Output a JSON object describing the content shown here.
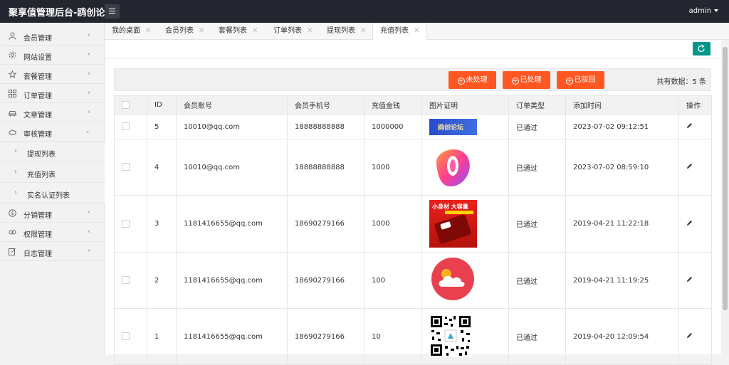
{
  "header": {
    "brand": "聚享值管理后台-鸥创论",
    "user": "admin"
  },
  "sidebar": {
    "items": [
      {
        "label": "会员管理",
        "icon": "user-icon",
        "arrow": "‹"
      },
      {
        "label": "网站设置",
        "icon": "gear-icon",
        "arrow": "‹"
      },
      {
        "label": "套餐管理",
        "icon": "star-icon",
        "arrow": "‹"
      },
      {
        "label": "订单管理",
        "icon": "grid-icon",
        "arrow": "‹"
      },
      {
        "label": "文章管理",
        "icon": "car-icon",
        "arrow": "‹"
      },
      {
        "label": "审核管理",
        "icon": "hand-icon",
        "arrow": "⌄"
      },
      {
        "label": "分销管理",
        "icon": "dollar-icon",
        "arrow": "‹"
      },
      {
        "label": "权限管理",
        "icon": "link-icon",
        "arrow": "‹"
      },
      {
        "label": "日志管理",
        "icon": "edit-icon",
        "arrow": "‹"
      }
    ],
    "subitems": [
      {
        "label": "提现列表"
      },
      {
        "label": "充值列表"
      },
      {
        "label": "实名认证列表"
      }
    ]
  },
  "tabs": [
    {
      "label": "我的桌面"
    },
    {
      "label": "会员列表"
    },
    {
      "label": "套餐列表"
    },
    {
      "label": "订单列表"
    },
    {
      "label": "提现列表"
    },
    {
      "label": "充值列表"
    }
  ],
  "toolbar": {
    "btn_pending": "未处理",
    "btn_processed": "已处理",
    "btn_rejected": "已驳回",
    "total": "共有数据：5 条"
  },
  "table": {
    "columns": [
      "ID",
      "会员账号",
      "会员手机号",
      "充值金钱",
      "图片证明",
      "订单类型",
      "添加时间",
      "操作"
    ],
    "rows": [
      {
        "id": "5",
        "account": "10010@qq.com",
        "phone": "18888888888",
        "amount": "1000000",
        "image_text": "鸥创论坛",
        "type": "已通过",
        "time": "2023-07-02 09:12:51"
      },
      {
        "id": "4",
        "account": "10010@qq.com",
        "phone": "18888888888",
        "amount": "1000",
        "type": "已通过",
        "time": "2023-07-02 08:59:10"
      },
      {
        "id": "3",
        "account": "1181416655@qq.com",
        "phone": "18690279166",
        "amount": "1000",
        "image_text": "小身材 大容量",
        "type": "已通过",
        "time": "2019-04-21 11:22:18"
      },
      {
        "id": "2",
        "account": "1181416655@qq.com",
        "phone": "18690279166",
        "amount": "100",
        "type": "已通过",
        "time": "2019-04-21 11:19:25"
      },
      {
        "id": "1",
        "account": "1181416655@qq.com",
        "phone": "18690279166",
        "amount": "10",
        "type": "已通过",
        "time": "2019-04-20 12:09:54"
      }
    ]
  },
  "colors": {
    "topbar": "#23262e",
    "accent": "#009688",
    "danger": "#ff5722"
  }
}
